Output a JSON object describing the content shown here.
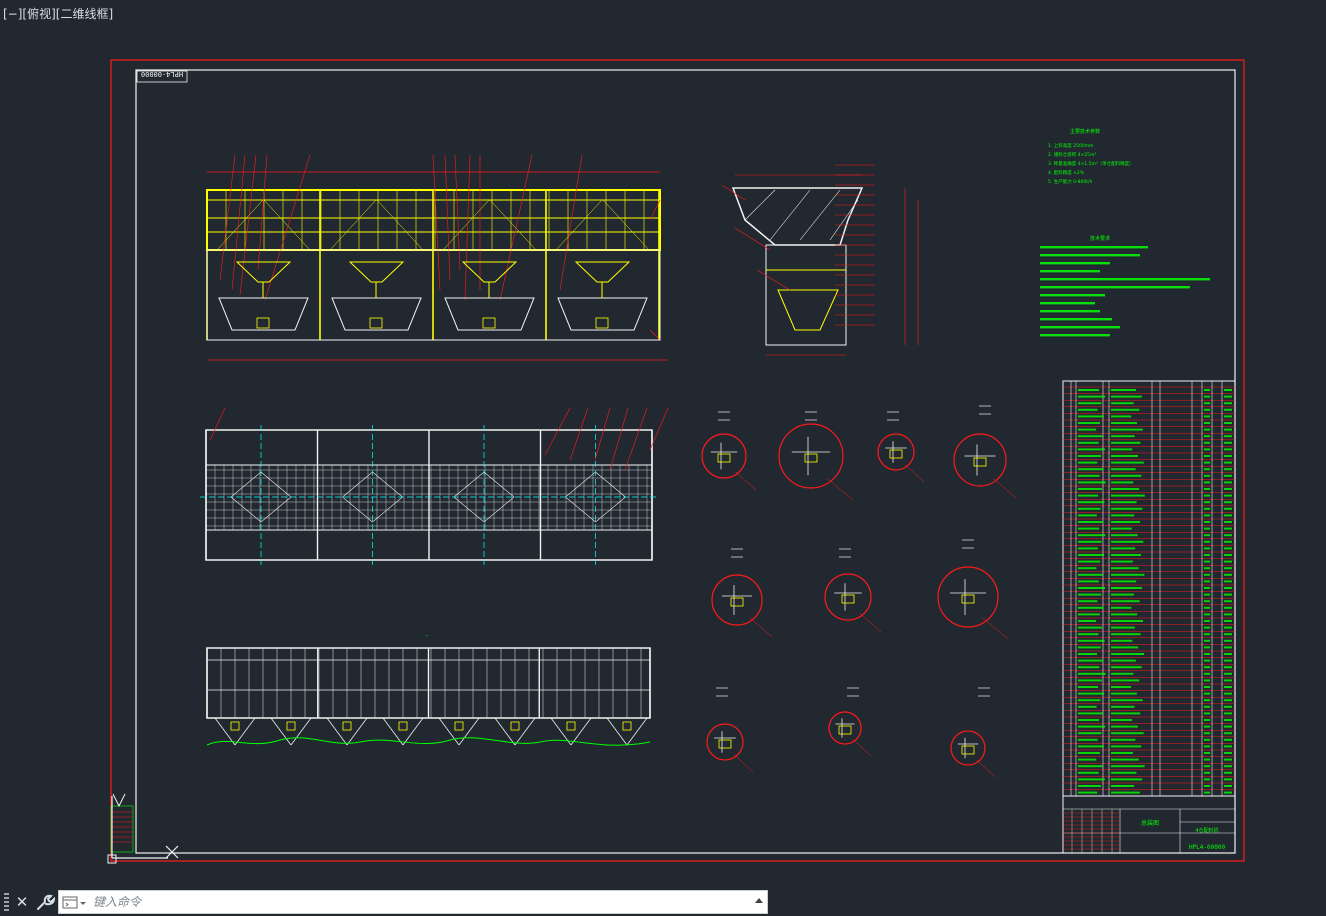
{
  "viewport": {
    "label": "[−][俯视][二维线框]"
  },
  "drawing": {
    "drawing_number": "HPL4-00000",
    "title_block": {
      "drawing_name": "总装图",
      "product_name": "4仓配料机",
      "drawing_number": "HPL4-00000"
    },
    "tech_params_title": "主要技术参数",
    "tech_params": [
      "1. 上料高度  2500mm",
      "2. 储料仓容积  4×25m³",
      "3. 称量准确度  4×1.5m³（单仓配料精度）",
      "4. 配料精度  ±2%",
      "5. 生产能力  0-800t/h"
    ],
    "notes_title": "技术要求",
    "section_labels": [
      "A",
      "B",
      "C",
      "D-D",
      "F",
      "G",
      "H-H",
      "J",
      "K",
      "L"
    ],
    "colors": {
      "background": "#212830",
      "frame_red": "#ff1a1a",
      "frame_white": "#f2f2f2",
      "yellow": "#ffff00",
      "green": "#00ff00",
      "cyan": "#00ffff"
    }
  },
  "command": {
    "placeholder": "键入命令"
  },
  "icons": {
    "close": "close-icon",
    "wrench": "wrench-icon",
    "command": "command-prompt-icon",
    "up": "chevron-up-icon",
    "ucs": "ucs-icon"
  }
}
